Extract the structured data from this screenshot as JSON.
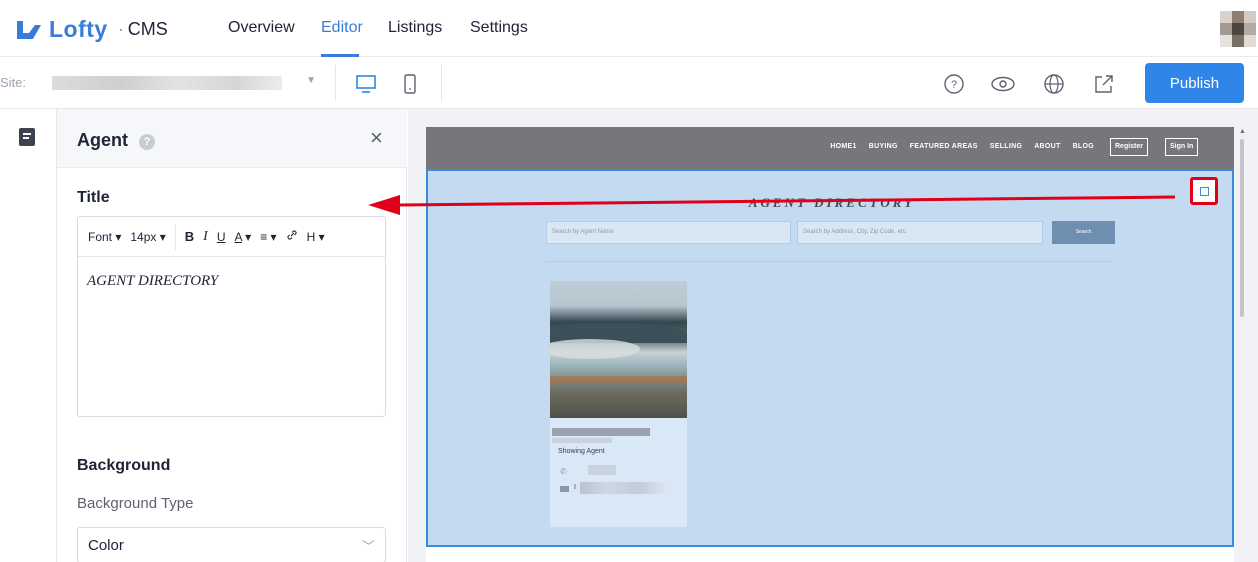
{
  "app": {
    "logo_text": "Lofty",
    "logo_separator": "·",
    "product": "CMS"
  },
  "nav": {
    "tabs": [
      {
        "label": "Overview"
      },
      {
        "label": "Editor"
      },
      {
        "label": "Listings"
      },
      {
        "label": "Settings"
      }
    ],
    "active_tab": "Editor"
  },
  "toolbar": {
    "site_label": "Site:",
    "publish_label": "Publish",
    "icons": [
      "desktop-icon",
      "mobile-icon",
      "help-icon",
      "preview-eye-icon",
      "globe-icon",
      "share-icon"
    ]
  },
  "panel": {
    "title": "Agent",
    "help": "?",
    "close": "×",
    "title_section": "Title",
    "editor_toolbar": {
      "font": "Font",
      "size": "14px",
      "bold": "B",
      "italic": "I",
      "underline": "U",
      "color": "A",
      "align": "≡",
      "link": "🔗",
      "heading": "H"
    },
    "editor_content": "AGENT DIRECTORY",
    "background_section": "Background",
    "background_type_label": "Background Type",
    "background_type_value": "Color"
  },
  "preview": {
    "nav_links": [
      "HOME1",
      "BUYING",
      "FEATURED AREAS",
      "SELLING",
      "ABOUT",
      "BLOG"
    ],
    "register": "Register",
    "sign_in": "Sign In",
    "directory_title": "AGENT DIRECTORY",
    "search_name_placeholder": "Search by Agent Name",
    "search_address_placeholder": "Search by Address, City, Zip Code, etc.",
    "search_button": "Search",
    "card_role": "Showing Agent",
    "mail_prefix": "I"
  },
  "colors": {
    "brand": "#3a7cd9",
    "publish": "#2f85e8",
    "selection": "#3b8ddc",
    "annotation": "#e0001a"
  }
}
